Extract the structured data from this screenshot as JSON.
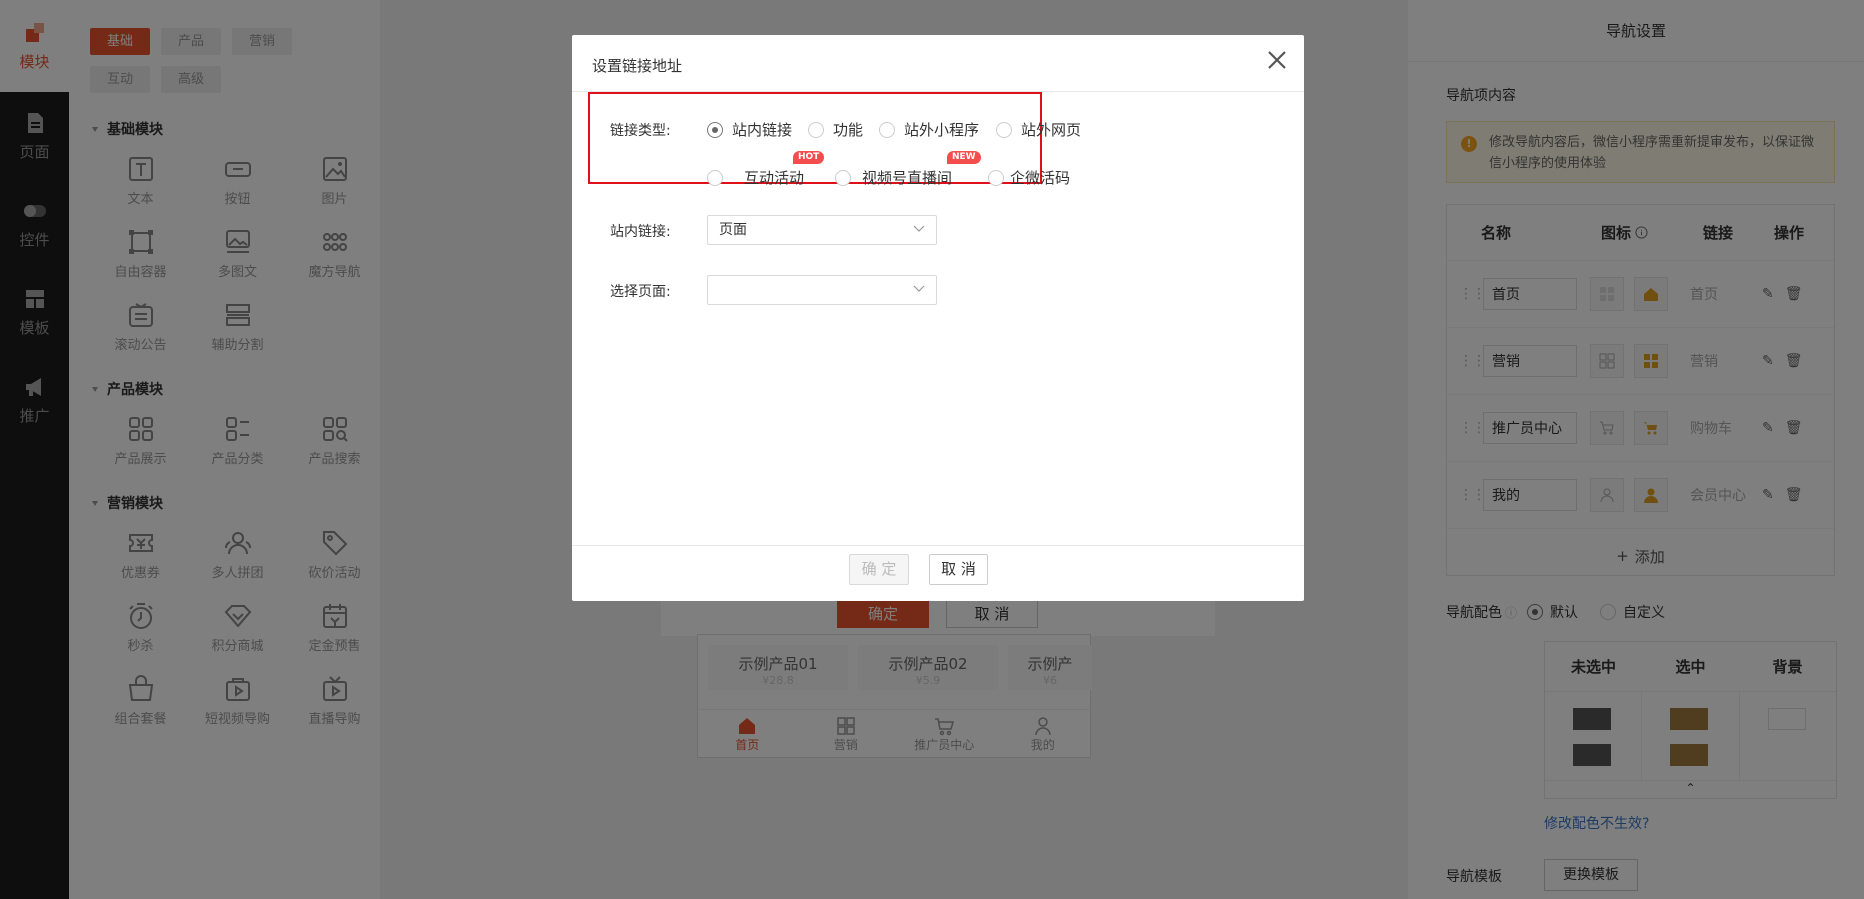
{
  "rail": {
    "items": [
      {
        "label": "模块",
        "icon": "module-icon"
      },
      {
        "label": "页面",
        "icon": "page-icon"
      },
      {
        "label": "控件",
        "icon": "toggle-icon"
      },
      {
        "label": "模板",
        "icon": "template-icon"
      },
      {
        "label": "推广",
        "icon": "megaphone-icon"
      }
    ]
  },
  "panel": {
    "tabs": [
      "基础",
      "产品",
      "营销",
      "互动",
      "高级"
    ],
    "sections": [
      {
        "title": "基础模块",
        "items": [
          "文本",
          "按钮",
          "图片",
          "自由容器",
          "多图文",
          "魔方导航",
          "滚动公告",
          "辅助分割"
        ]
      },
      {
        "title": "产品模块",
        "items": [
          "产品展示",
          "产品分类",
          "产品搜索"
        ]
      },
      {
        "title": "营销模块",
        "items": [
          "优惠券",
          "多人拼团",
          "砍价活动",
          "秒杀",
          "积分商城",
          "定金预售",
          "组合套餐",
          "短视频导购",
          "直播导购"
        ]
      }
    ]
  },
  "canvas": {
    "products": [
      {
        "name": "示例产品01",
        "price": "¥28.8"
      },
      {
        "name": "示例产品02",
        "price": "¥5.9"
      },
      {
        "name": "示例产",
        "price": "¥6"
      }
    ],
    "tabbar": [
      "首页",
      "营销",
      "推广员中心",
      "我的"
    ],
    "under_ok": "确定",
    "under_cancel": "取 消"
  },
  "right": {
    "header": "导航设置",
    "content_label": "导航项内容",
    "notice": "修改导航内容后，微信小程序需重新提审发布，以保证微信小程序的使用体验",
    "columns": [
      "名称",
      "图标",
      "链接",
      "操作"
    ],
    "rows": [
      {
        "name": "首页",
        "link": "首页",
        "icon": "home-icon"
      },
      {
        "name": "营销",
        "link": "营销",
        "icon": "grid-icon"
      },
      {
        "name": "推广员中心",
        "link": "购物车",
        "icon": "cart-icon"
      },
      {
        "name": "我的",
        "link": "会员中心",
        "icon": "user-icon"
      }
    ],
    "add_label": "添加",
    "color_label": "导航配色",
    "color_options": [
      "默认",
      "自定义"
    ],
    "color_selected": "默认",
    "color_columns": [
      "未选中",
      "选中",
      "背景"
    ],
    "colors": {
      "unselected": "#555555",
      "selected": "#a07a40",
      "background": "#ffffff"
    },
    "color_help": "修改配色不生效?",
    "template_label": "导航模板",
    "template_button": "更换模板"
  },
  "modal": {
    "title": "设置链接地址",
    "link_type_label": "链接类型:",
    "options_row1": [
      "站内链接",
      "功能",
      "站外小程序",
      "站外网页"
    ],
    "options_row2": [
      "互动活动",
      "视频号直播间",
      "企微活码"
    ],
    "selected": "站内链接",
    "badge_hot": "HOT",
    "badge_new": "NEW",
    "inner_link_label": "站内链接:",
    "inner_link_value": "页面",
    "page_label": "选择页面:",
    "page_value": "",
    "ok": "确 定",
    "cancel": "取 消"
  },
  "colors": {
    "accent": "#e8542e",
    "highlight": "#e0101b",
    "badge": "#f34d4d"
  }
}
